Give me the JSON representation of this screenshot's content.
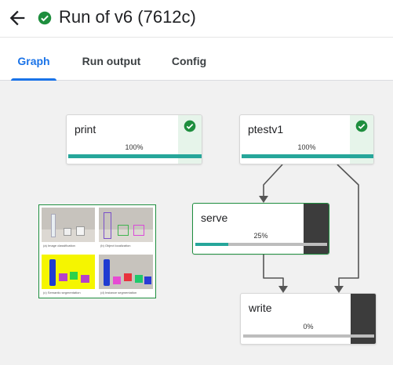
{
  "header": {
    "title": "Run of v6 (7612c)",
    "back_icon": "arrow-back-icon",
    "status_icon": "check-circle-icon",
    "status_color": "#1e8e3e"
  },
  "tabs": [
    {
      "label": "Graph",
      "active": true
    },
    {
      "label": "Run output",
      "active": false
    },
    {
      "label": "Config",
      "active": false
    }
  ],
  "colors": {
    "accent": "#1a73e8",
    "progress": "#26a69a",
    "success": "#1e8e3e",
    "running": "#3c3c3c"
  },
  "graph": {
    "nodes": [
      {
        "id": "print",
        "label": "print",
        "progress_text": "100%",
        "progress": 1.0,
        "status": "succeeded"
      },
      {
        "id": "ptestv1",
        "label": "ptestv1",
        "progress_text": "100%",
        "progress": 1.0,
        "status": "succeeded"
      },
      {
        "id": "serve",
        "label": "serve",
        "progress_text": "25%",
        "progress": 0.25,
        "status": "running"
      },
      {
        "id": "write",
        "label": "write",
        "progress_text": "0%",
        "progress": 0.0,
        "status": "running"
      }
    ],
    "edges": [
      {
        "from": "ptestv1",
        "to": "serve"
      },
      {
        "from": "ptestv1",
        "to": "write"
      },
      {
        "from": "serve",
        "to": "write"
      }
    ]
  },
  "preview": {
    "captions": [
      "(a) Image classification",
      "(b) Object localization",
      "(c) Semantic segmentation",
      "(d) Instance segmentation"
    ]
  }
}
